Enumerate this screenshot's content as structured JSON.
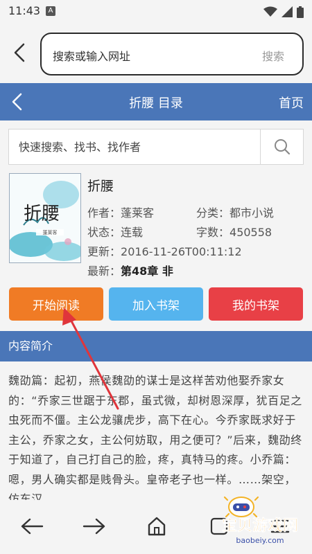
{
  "status": {
    "time": "11:43",
    "notify": "A"
  },
  "browser": {
    "url_placeholder": "搜索或输入网址",
    "search_label": "搜索"
  },
  "header": {
    "title": "折腰 目录",
    "home": "首页"
  },
  "search": {
    "placeholder": "快速搜索、找书、找作者"
  },
  "book": {
    "title": "折腰",
    "cover_title": "折腰",
    "cover_author": "蓬莱客",
    "author_label": "作者：",
    "author": "蓬莱客",
    "category_label": "分类：",
    "category": "都市小说",
    "status_label": "状态：",
    "status": "连载",
    "words_label": "字数：",
    "words": "450558",
    "updated_label": "更新：",
    "updated": "2016-11-26T00:11:12",
    "latest_label": "最新：",
    "latest": "第48章 非"
  },
  "actions": {
    "start": "开始阅读",
    "add": "加入书架",
    "shelf": "我的书架"
  },
  "intro": {
    "heading": "内容简介",
    "text": "魏劭篇：起初，燕侯魏劭的谋士是这样苦劝他娶乔家女的：“乔家三世踞于东郡，虽式微，却树恩深厚，犹百足之虫死而不僵。主公龙骧虎步，高下在心。今乔家既求好于主公，乔家之女，主公何妨取，用之便可？”后来，魏劭终于知道了，自己打自己的脸，疼，真特马的疼。小乔篇：嗯，男人确实都是贱骨头。皇帝老子也一样。……架空，仿东汉"
  },
  "watermark": {
    "name": "宝贝游戏网",
    "url": "baobeiy.com"
  },
  "colors": {
    "header": "#4a76b8",
    "start": "#f07b25",
    "add": "#55b4ee",
    "shelf": "#e84046",
    "annotation": "#e0353b"
  }
}
